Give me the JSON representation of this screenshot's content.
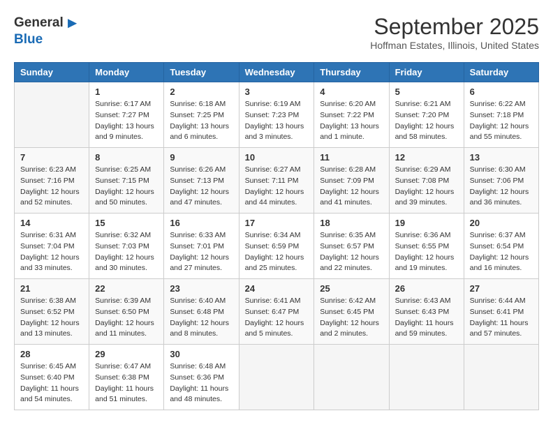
{
  "header": {
    "logo_general": "General",
    "logo_blue": "Blue",
    "month_title": "September 2025",
    "location": "Hoffman Estates, Illinois, United States"
  },
  "calendar": {
    "days_of_week": [
      "Sunday",
      "Monday",
      "Tuesday",
      "Wednesday",
      "Thursday",
      "Friday",
      "Saturday"
    ],
    "weeks": [
      [
        {
          "day": "",
          "sunrise": "",
          "sunset": "",
          "daylight": ""
        },
        {
          "day": "1",
          "sunrise": "Sunrise: 6:17 AM",
          "sunset": "Sunset: 7:27 PM",
          "daylight": "Daylight: 13 hours and 9 minutes."
        },
        {
          "day": "2",
          "sunrise": "Sunrise: 6:18 AM",
          "sunset": "Sunset: 7:25 PM",
          "daylight": "Daylight: 13 hours and 6 minutes."
        },
        {
          "day": "3",
          "sunrise": "Sunrise: 6:19 AM",
          "sunset": "Sunset: 7:23 PM",
          "daylight": "Daylight: 13 hours and 3 minutes."
        },
        {
          "day": "4",
          "sunrise": "Sunrise: 6:20 AM",
          "sunset": "Sunset: 7:22 PM",
          "daylight": "Daylight: 13 hours and 1 minute."
        },
        {
          "day": "5",
          "sunrise": "Sunrise: 6:21 AM",
          "sunset": "Sunset: 7:20 PM",
          "daylight": "Daylight: 12 hours and 58 minutes."
        },
        {
          "day": "6",
          "sunrise": "Sunrise: 6:22 AM",
          "sunset": "Sunset: 7:18 PM",
          "daylight": "Daylight: 12 hours and 55 minutes."
        }
      ],
      [
        {
          "day": "7",
          "sunrise": "Sunrise: 6:23 AM",
          "sunset": "Sunset: 7:16 PM",
          "daylight": "Daylight: 12 hours and 52 minutes."
        },
        {
          "day": "8",
          "sunrise": "Sunrise: 6:25 AM",
          "sunset": "Sunset: 7:15 PM",
          "daylight": "Daylight: 12 hours and 50 minutes."
        },
        {
          "day": "9",
          "sunrise": "Sunrise: 6:26 AM",
          "sunset": "Sunset: 7:13 PM",
          "daylight": "Daylight: 12 hours and 47 minutes."
        },
        {
          "day": "10",
          "sunrise": "Sunrise: 6:27 AM",
          "sunset": "Sunset: 7:11 PM",
          "daylight": "Daylight: 12 hours and 44 minutes."
        },
        {
          "day": "11",
          "sunrise": "Sunrise: 6:28 AM",
          "sunset": "Sunset: 7:09 PM",
          "daylight": "Daylight: 12 hours and 41 minutes."
        },
        {
          "day": "12",
          "sunrise": "Sunrise: 6:29 AM",
          "sunset": "Sunset: 7:08 PM",
          "daylight": "Daylight: 12 hours and 39 minutes."
        },
        {
          "day": "13",
          "sunrise": "Sunrise: 6:30 AM",
          "sunset": "Sunset: 7:06 PM",
          "daylight": "Daylight: 12 hours and 36 minutes."
        }
      ],
      [
        {
          "day": "14",
          "sunrise": "Sunrise: 6:31 AM",
          "sunset": "Sunset: 7:04 PM",
          "daylight": "Daylight: 12 hours and 33 minutes."
        },
        {
          "day": "15",
          "sunrise": "Sunrise: 6:32 AM",
          "sunset": "Sunset: 7:03 PM",
          "daylight": "Daylight: 12 hours and 30 minutes."
        },
        {
          "day": "16",
          "sunrise": "Sunrise: 6:33 AM",
          "sunset": "Sunset: 7:01 PM",
          "daylight": "Daylight: 12 hours and 27 minutes."
        },
        {
          "day": "17",
          "sunrise": "Sunrise: 6:34 AM",
          "sunset": "Sunset: 6:59 PM",
          "daylight": "Daylight: 12 hours and 25 minutes."
        },
        {
          "day": "18",
          "sunrise": "Sunrise: 6:35 AM",
          "sunset": "Sunset: 6:57 PM",
          "daylight": "Daylight: 12 hours and 22 minutes."
        },
        {
          "day": "19",
          "sunrise": "Sunrise: 6:36 AM",
          "sunset": "Sunset: 6:55 PM",
          "daylight": "Daylight: 12 hours and 19 minutes."
        },
        {
          "day": "20",
          "sunrise": "Sunrise: 6:37 AM",
          "sunset": "Sunset: 6:54 PM",
          "daylight": "Daylight: 12 hours and 16 minutes."
        }
      ],
      [
        {
          "day": "21",
          "sunrise": "Sunrise: 6:38 AM",
          "sunset": "Sunset: 6:52 PM",
          "daylight": "Daylight: 12 hours and 13 minutes."
        },
        {
          "day": "22",
          "sunrise": "Sunrise: 6:39 AM",
          "sunset": "Sunset: 6:50 PM",
          "daylight": "Daylight: 12 hours and 11 minutes."
        },
        {
          "day": "23",
          "sunrise": "Sunrise: 6:40 AM",
          "sunset": "Sunset: 6:48 PM",
          "daylight": "Daylight: 12 hours and 8 minutes."
        },
        {
          "day": "24",
          "sunrise": "Sunrise: 6:41 AM",
          "sunset": "Sunset: 6:47 PM",
          "daylight": "Daylight: 12 hours and 5 minutes."
        },
        {
          "day": "25",
          "sunrise": "Sunrise: 6:42 AM",
          "sunset": "Sunset: 6:45 PM",
          "daylight": "Daylight: 12 hours and 2 minutes."
        },
        {
          "day": "26",
          "sunrise": "Sunrise: 6:43 AM",
          "sunset": "Sunset: 6:43 PM",
          "daylight": "Daylight: 11 hours and 59 minutes."
        },
        {
          "day": "27",
          "sunrise": "Sunrise: 6:44 AM",
          "sunset": "Sunset: 6:41 PM",
          "daylight": "Daylight: 11 hours and 57 minutes."
        }
      ],
      [
        {
          "day": "28",
          "sunrise": "Sunrise: 6:45 AM",
          "sunset": "Sunset: 6:40 PM",
          "daylight": "Daylight: 11 hours and 54 minutes."
        },
        {
          "day": "29",
          "sunrise": "Sunrise: 6:47 AM",
          "sunset": "Sunset: 6:38 PM",
          "daylight": "Daylight: 11 hours and 51 minutes."
        },
        {
          "day": "30",
          "sunrise": "Sunrise: 6:48 AM",
          "sunset": "Sunset: 6:36 PM",
          "daylight": "Daylight: 11 hours and 48 minutes."
        },
        {
          "day": "",
          "sunrise": "",
          "sunset": "",
          "daylight": ""
        },
        {
          "day": "",
          "sunrise": "",
          "sunset": "",
          "daylight": ""
        },
        {
          "day": "",
          "sunrise": "",
          "sunset": "",
          "daylight": ""
        },
        {
          "day": "",
          "sunrise": "",
          "sunset": "",
          "daylight": ""
        }
      ]
    ]
  }
}
